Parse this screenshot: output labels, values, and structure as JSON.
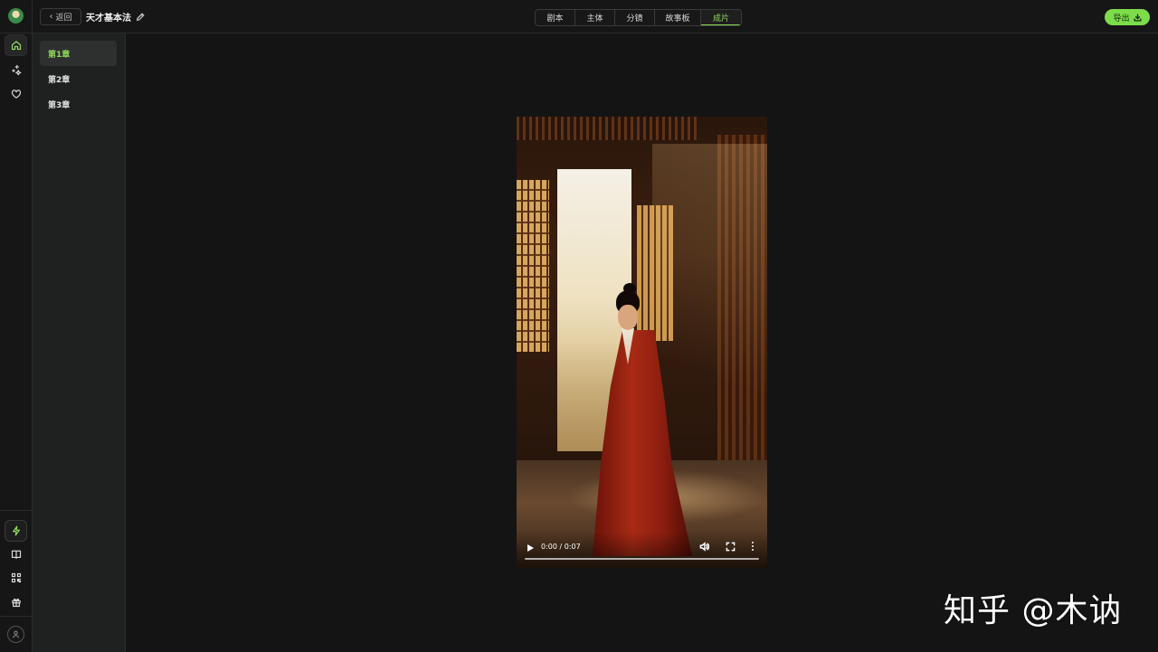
{
  "header": {
    "back_label": "返回",
    "project_title": "天才基本法",
    "tabs": [
      {
        "label": "剧本"
      },
      {
        "label": "主体"
      },
      {
        "label": "分镜"
      },
      {
        "label": "故事板"
      },
      {
        "label": "成片"
      }
    ],
    "active_tab": "成片",
    "export_label": "导出"
  },
  "rail": {
    "top_items": [
      {
        "icon": "home-icon",
        "active": true
      },
      {
        "icon": "sparkles-icon",
        "active": false
      },
      {
        "icon": "heart-icon",
        "active": false
      }
    ],
    "bottom_items": [
      {
        "icon": "flash-icon"
      },
      {
        "icon": "book-icon"
      },
      {
        "icon": "qr-code-icon"
      },
      {
        "icon": "gift-icon"
      }
    ],
    "avatar_icon": "user-icon"
  },
  "chapters": [
    {
      "label": "第1章",
      "active": true
    },
    {
      "label": "第2章",
      "active": false
    },
    {
      "label": "第3章",
      "active": false
    }
  ],
  "video": {
    "time": "0:00 / 0:07",
    "progress": 0.0
  },
  "watermark": "知乎 @木讷",
  "colors": {
    "accent": "#8fd85a",
    "export_bg": "#7ddc4a",
    "background": "#141414",
    "sidebar": "#1f2121"
  }
}
